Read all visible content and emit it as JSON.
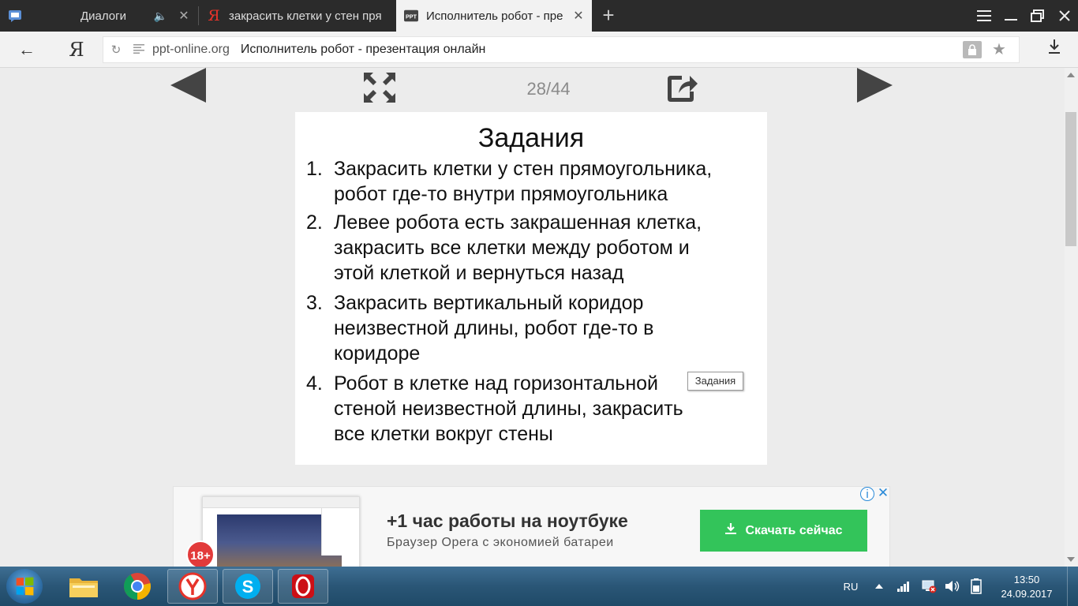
{
  "browser": {
    "tabs": [
      {
        "title": "Диалоги",
        "icon": "chat-icon",
        "audio": true
      },
      {
        "title": "закрасить клетки у стен пря",
        "icon": "yandex-icon"
      },
      {
        "title": "Исполнитель робот - пре",
        "icon": "ppt-icon",
        "active": true
      }
    ],
    "new_tab": "+",
    "ya_label": "Я",
    "address": {
      "host": "ppt-online.org",
      "page_title": "Исполнитель робот - презентация онлайн"
    }
  },
  "viewer": {
    "counter": "28/44",
    "current_page": 28,
    "total_pages": 44
  },
  "slide": {
    "title": "Задания",
    "tasks": [
      {
        "num": "1.",
        "lines": [
          "Закрасить клетки у стен прямоугольника,",
          "робот где-то внутри прямоугольника"
        ]
      },
      {
        "num": "2.",
        "lines": [
          "Левее робота есть закрашенная клетка,",
          "закрасить все клетки между роботом и",
          "этой клеткой и вернуться назад"
        ]
      },
      {
        "num": "3.",
        "lines": [
          "Закрасить вертикальный коридор",
          "неизвестной длины, робот где-то в",
          "коридоре"
        ]
      },
      {
        "num": "4.",
        "lines": [
          "Робот в клетке над горизонтальной",
          "стеной неизвестной длины, закрасить",
          "все клетки вокруг стены"
        ]
      }
    ],
    "tooltip": "Задания"
  },
  "ad": {
    "age_badge": "18+",
    "headline": "+1 час работы на ноутбуке",
    "subline": "Браузер Opera с экономией батареи",
    "button": "Скачать сейчас",
    "info": "i",
    "close": "✕",
    "button_color": "#33c45a"
  },
  "taskbar": {
    "language": "RU",
    "time": "13:50",
    "date": "24.09.2017"
  },
  "colors": {
    "tabbar_bg": "#2b2b2b",
    "page_bg": "#ececec",
    "taskbar_bg": "#2a5676"
  }
}
